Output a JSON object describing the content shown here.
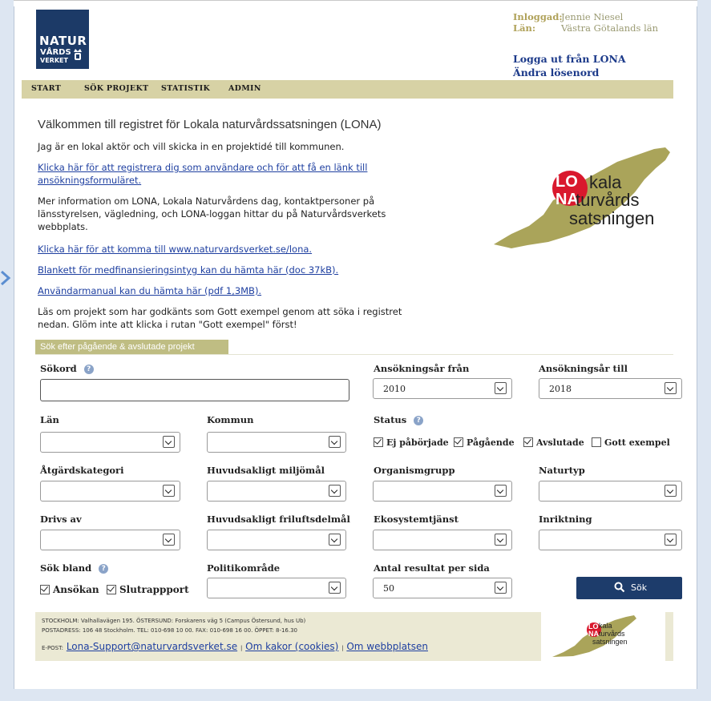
{
  "logo": {
    "line1": "NATUR",
    "line2": "VÅRDS",
    "line3": "VERKET"
  },
  "user": {
    "logged_in_label": "Inloggad:",
    "logged_in_value": "Jennie Niesel",
    "lan_label": "Län:",
    "lan_value": "Västra Götalands län"
  },
  "account": {
    "logout": "Logga ut från LONA",
    "change_password": "Ändra lösenord"
  },
  "nav": {
    "items": [
      "START",
      "SÖK PROJEKT",
      "STATISTIK",
      "ADMIN"
    ]
  },
  "intro": {
    "title": "Välkommen till registret för Lokala naturvårdssatsningen (LONA)",
    "p1": "Jag är en lokal aktör och vill skicka in en projektidé till kommunen.",
    "link_register_1": "Klicka här för att registrera dig som användare och för att få en länk till",
    "link_register_2": "ansökningsformuläret.",
    "p2_1": "Mer information om LONA, Lokala Naturvårdens dag, kontaktpersoner på",
    "p2_2": "länsstyrelsen, vägledning, och LONA-loggan hittar du på Naturvårdsverkets",
    "p2_3": "webbplats.",
    "link_lona": "Klicka här för att komma till www.naturvardsverket.se/lona.",
    "link_blankett": "Blankett för medfinansieringsintyg kan du hämta här (doc 37kB).",
    "link_manual": "Användarmanual kan du hämta här (pdf 1,3MB).",
    "p3_1": "Läs om projekt som har godkänts som Gott exempel genom att söka i registret",
    "p3_2": "nedan. Glöm inte att klicka i rutan \"Gott exempel\" först!"
  },
  "lona_logo": {
    "lo": "LO",
    "kala": "kala",
    "na": "NA",
    "turvards": "turvårds",
    "satsningen": "satsningen"
  },
  "search": {
    "tab": "Sök efter pågående & avslutade projekt",
    "sokord": "Sökord",
    "ar_fran": "Ansökningsår från",
    "ar_fran_value": "2010",
    "ar_till": "Ansökningsår till",
    "ar_till_value": "2018",
    "lan": "Län",
    "kommun": "Kommun",
    "status": "Status",
    "status_options": [
      "Ej påbörjade",
      "Pågående",
      "Avslutade",
      "Gott exempel"
    ],
    "atgardskategori": "Åtgärdskategori",
    "miljomal": "Huvudsakligt miljömål",
    "organismgrupp": "Organismgrupp",
    "naturtyp": "Naturtyp",
    "drivs_av": "Drivs av",
    "friluftsdelmal": "Huvudsakligt friluftsdelmål",
    "ekosystemtjanst": "Ekosystemtjänst",
    "inriktning": "Inriktning",
    "sok_bland": "Sök bland",
    "sok_bland_options": [
      "Ansökan",
      "Slutrappport"
    ],
    "politikomrade": "Politikområde",
    "antal": "Antal resultat per sida",
    "antal_value": "50",
    "button": "Sök"
  },
  "footer": {
    "line1": "STOCKHOLM: Valhallavägen 195. ÖSTERSUND: Forskarens väg 5 (Campus Östersund, hus Ub)",
    "line2": "POSTADRESS: 106 48 Stockholm. TEL: 010-698 10 00. FAX: 010-698 16 00. ÖPPET: 8-16.30",
    "epost": "E-POST:",
    "email": "Lona-Support@naturvardsverket.se",
    "sep": "|",
    "cookies": "Om kakor (cookies)",
    "om": "Om webbplatsen"
  },
  "colors": {
    "nav_bg": "#d7d2a5",
    "brand_navy": "#1c3a67",
    "link": "#1e3fa0",
    "lona_red": "#d9182d",
    "lona_green": "#aaa45a"
  }
}
